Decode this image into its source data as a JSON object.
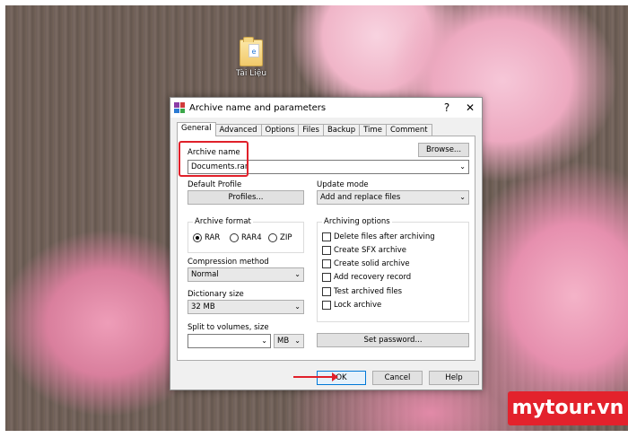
{
  "desktop": {
    "icon_label": "Tài Liệu"
  },
  "dialog": {
    "title": "Archive name and parameters",
    "help_glyph": "?",
    "close_glyph": "✕",
    "tabs": [
      {
        "label": "General",
        "active": true
      },
      {
        "label": "Advanced"
      },
      {
        "label": "Options"
      },
      {
        "label": "Files"
      },
      {
        "label": "Backup"
      },
      {
        "label": "Time"
      },
      {
        "label": "Comment"
      }
    ],
    "archive_name_label": "Archive name",
    "archive_name_value": "Documents.rar",
    "browse_label": "Browse...",
    "default_profile_label": "Default Profile",
    "profiles_label": "Profiles...",
    "update_mode_label": "Update mode",
    "update_mode_value": "Add and replace files",
    "archive_format_label": "Archive format",
    "formats": [
      {
        "label": "RAR",
        "selected": true
      },
      {
        "label": "RAR4",
        "selected": false
      },
      {
        "label": "ZIP",
        "selected": false
      }
    ],
    "compression_label": "Compression method",
    "compression_value": "Normal",
    "dictionary_label": "Dictionary size",
    "dictionary_value": "32 MB",
    "split_label": "Split to volumes, size",
    "split_value": "",
    "split_unit": "MB",
    "archiving_options_label": "Archiving options",
    "options": [
      {
        "label": "Delete files after archiving",
        "checked": false
      },
      {
        "label": "Create SFX archive",
        "checked": false
      },
      {
        "label": "Create solid archive",
        "checked": false
      },
      {
        "label": "Add recovery record",
        "checked": false
      },
      {
        "label": "Test archived files",
        "checked": false
      },
      {
        "label": "Lock archive",
        "checked": false
      }
    ],
    "set_password_label": "Set password...",
    "ok_label": "OK",
    "cancel_label": "Cancel",
    "help_label": "Help"
  },
  "watermark": "mytour.vn",
  "colors": {
    "highlight": "#e0202a",
    "brand": "#e3222c"
  }
}
